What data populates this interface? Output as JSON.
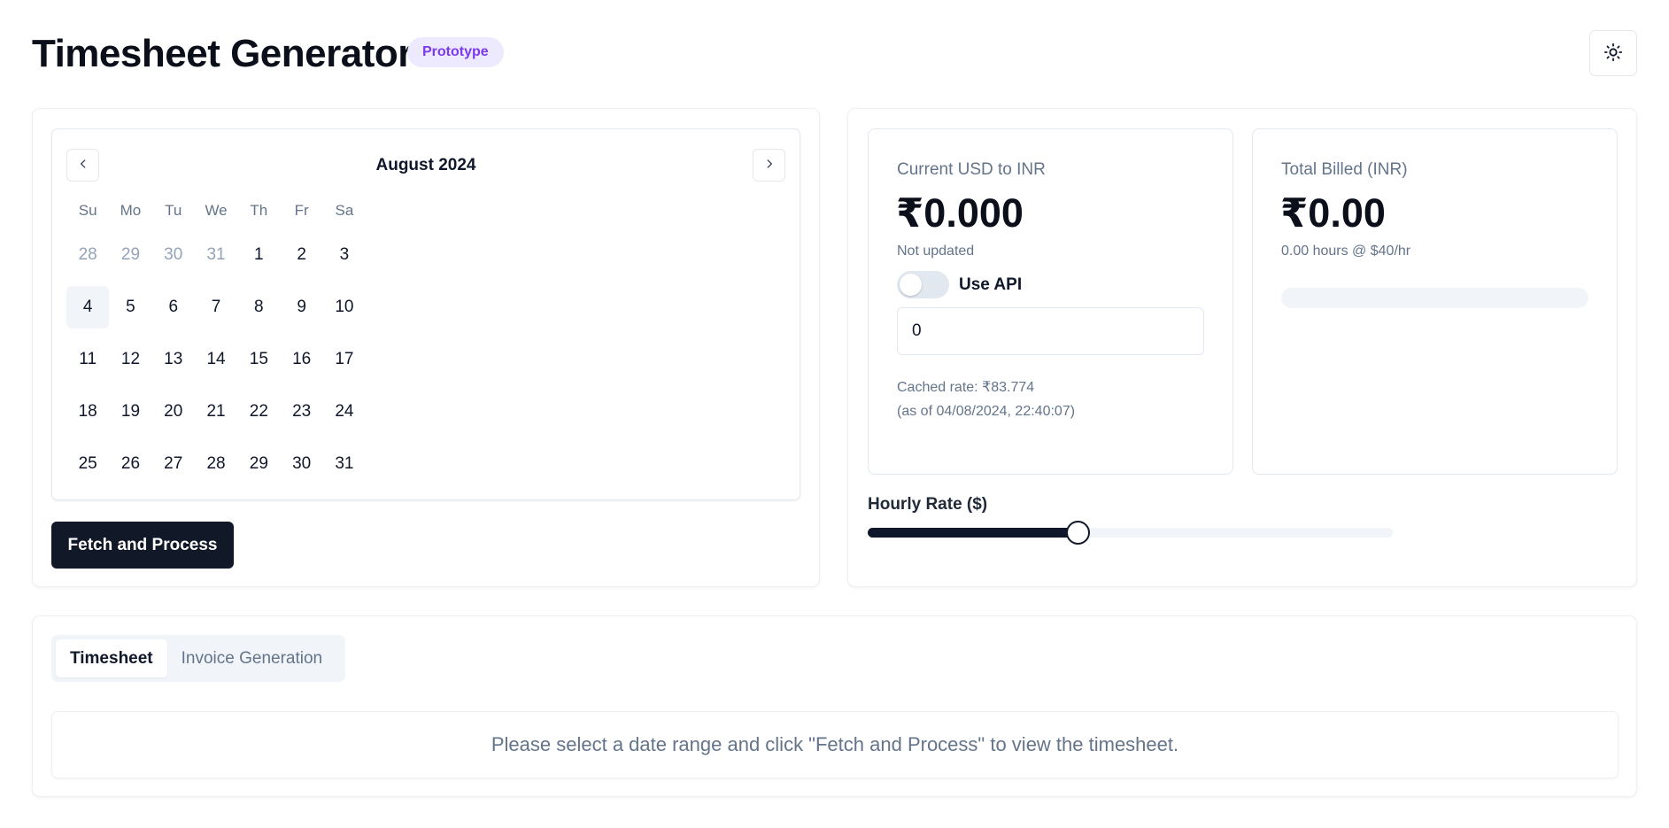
{
  "header": {
    "title": "Timesheet Generator",
    "badge": "Prototype",
    "theme_icon": "sun-icon"
  },
  "calendar": {
    "month_label": "August 2024",
    "prev_icon": "chevron-left-icon",
    "next_icon": "chevron-right-icon",
    "weekdays": [
      "Su",
      "Mo",
      "Tu",
      "We",
      "Th",
      "Fr",
      "Sa"
    ],
    "weeks": [
      [
        {
          "d": "28",
          "outside": true
        },
        {
          "d": "29",
          "outside": true
        },
        {
          "d": "30",
          "outside": true
        },
        {
          "d": "31",
          "outside": true
        },
        {
          "d": "1"
        },
        {
          "d": "2"
        },
        {
          "d": "3"
        }
      ],
      [
        {
          "d": "4",
          "today": true
        },
        {
          "d": "5"
        },
        {
          "d": "6"
        },
        {
          "d": "7"
        },
        {
          "d": "8"
        },
        {
          "d": "9"
        },
        {
          "d": "10"
        }
      ],
      [
        {
          "d": "11"
        },
        {
          "d": "12"
        },
        {
          "d": "13"
        },
        {
          "d": "14"
        },
        {
          "d": "15"
        },
        {
          "d": "16"
        },
        {
          "d": "17"
        }
      ],
      [
        {
          "d": "18"
        },
        {
          "d": "19"
        },
        {
          "d": "20"
        },
        {
          "d": "21"
        },
        {
          "d": "22"
        },
        {
          "d": "23"
        },
        {
          "d": "24"
        }
      ],
      [
        {
          "d": "25"
        },
        {
          "d": "26"
        },
        {
          "d": "27"
        },
        {
          "d": "28"
        },
        {
          "d": "29"
        },
        {
          "d": "30"
        },
        {
          "d": "31"
        }
      ]
    ]
  },
  "fetch_button": "Fetch and Process",
  "rate_card": {
    "label": "Current USD to INR",
    "value": "₹0.000",
    "status": "Not updated",
    "toggle_label": "Use API",
    "toggle_on": false,
    "input_value": "0",
    "cached_line1": "Cached rate: ₹83.774",
    "cached_line2": "(as of 04/08/2024, 22:40:07)"
  },
  "billed_card": {
    "label": "Total Billed (INR)",
    "value": "₹0.00",
    "sub": "0.00 hours @ $40/hr",
    "progress_fraction": 0
  },
  "hourly_rate": {
    "label": "Hourly Rate ($)",
    "value": 40,
    "fraction": 0.4
  },
  "tabs": [
    {
      "label": "Timesheet",
      "active": true
    },
    {
      "label": "Invoice Generation",
      "active": false
    }
  ],
  "empty_message": "Please select a date range and click \"Fetch and Process\" to view the timesheet.",
  "colors": {
    "primary": "#111827",
    "badge_bg": "#ede9fe",
    "badge_text": "#7c3aed",
    "muted_text": "#64748b"
  }
}
